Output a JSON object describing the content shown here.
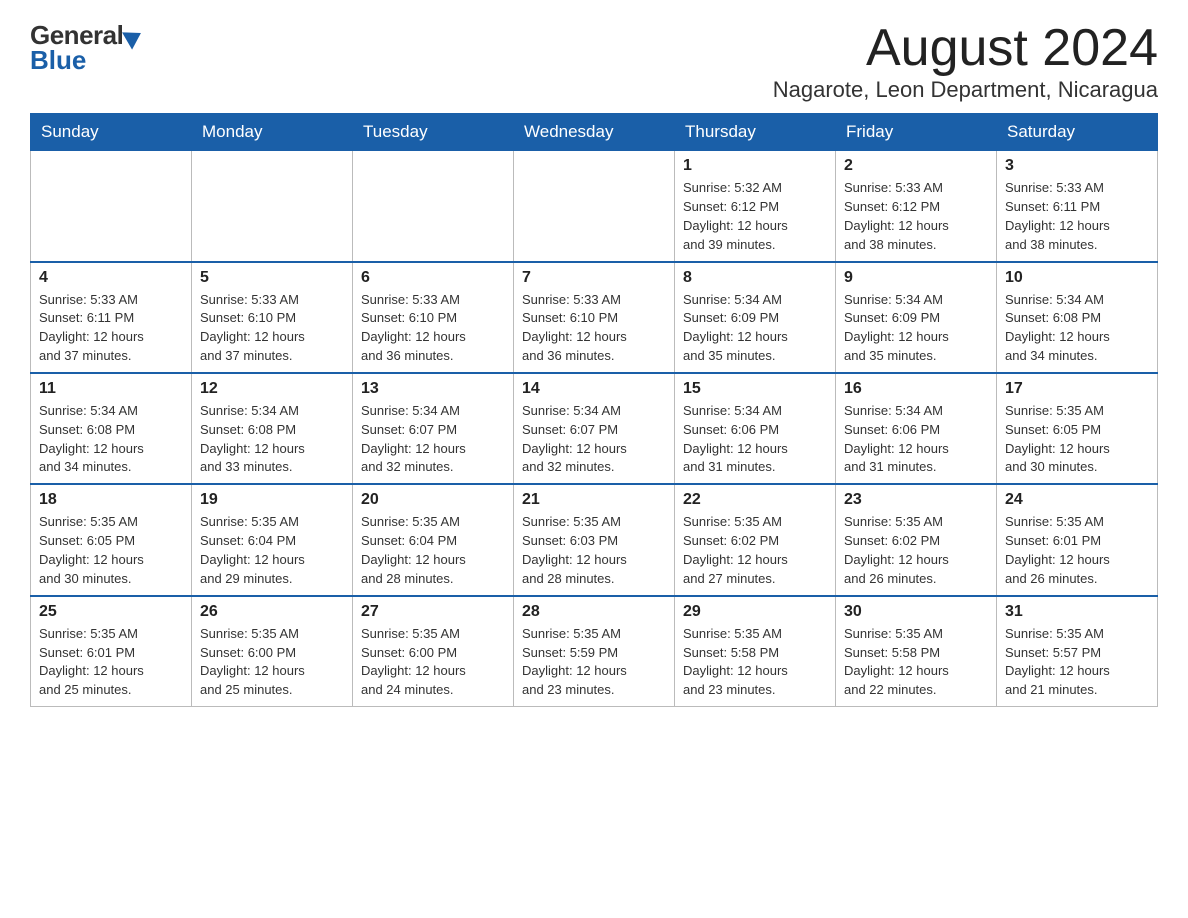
{
  "header": {
    "logo_general": "General",
    "logo_blue": "Blue",
    "month_year": "August 2024",
    "location": "Nagarote, Leon Department, Nicaragua"
  },
  "days_of_week": [
    "Sunday",
    "Monday",
    "Tuesday",
    "Wednesday",
    "Thursday",
    "Friday",
    "Saturday"
  ],
  "weeks": [
    [
      {
        "day": "",
        "info": ""
      },
      {
        "day": "",
        "info": ""
      },
      {
        "day": "",
        "info": ""
      },
      {
        "day": "",
        "info": ""
      },
      {
        "day": "1",
        "info": "Sunrise: 5:32 AM\nSunset: 6:12 PM\nDaylight: 12 hours\nand 39 minutes."
      },
      {
        "day": "2",
        "info": "Sunrise: 5:33 AM\nSunset: 6:12 PM\nDaylight: 12 hours\nand 38 minutes."
      },
      {
        "day": "3",
        "info": "Sunrise: 5:33 AM\nSunset: 6:11 PM\nDaylight: 12 hours\nand 38 minutes."
      }
    ],
    [
      {
        "day": "4",
        "info": "Sunrise: 5:33 AM\nSunset: 6:11 PM\nDaylight: 12 hours\nand 37 minutes."
      },
      {
        "day": "5",
        "info": "Sunrise: 5:33 AM\nSunset: 6:10 PM\nDaylight: 12 hours\nand 37 minutes."
      },
      {
        "day": "6",
        "info": "Sunrise: 5:33 AM\nSunset: 6:10 PM\nDaylight: 12 hours\nand 36 minutes."
      },
      {
        "day": "7",
        "info": "Sunrise: 5:33 AM\nSunset: 6:10 PM\nDaylight: 12 hours\nand 36 minutes."
      },
      {
        "day": "8",
        "info": "Sunrise: 5:34 AM\nSunset: 6:09 PM\nDaylight: 12 hours\nand 35 minutes."
      },
      {
        "day": "9",
        "info": "Sunrise: 5:34 AM\nSunset: 6:09 PM\nDaylight: 12 hours\nand 35 minutes."
      },
      {
        "day": "10",
        "info": "Sunrise: 5:34 AM\nSunset: 6:08 PM\nDaylight: 12 hours\nand 34 minutes."
      }
    ],
    [
      {
        "day": "11",
        "info": "Sunrise: 5:34 AM\nSunset: 6:08 PM\nDaylight: 12 hours\nand 34 minutes."
      },
      {
        "day": "12",
        "info": "Sunrise: 5:34 AM\nSunset: 6:08 PM\nDaylight: 12 hours\nand 33 minutes."
      },
      {
        "day": "13",
        "info": "Sunrise: 5:34 AM\nSunset: 6:07 PM\nDaylight: 12 hours\nand 32 minutes."
      },
      {
        "day": "14",
        "info": "Sunrise: 5:34 AM\nSunset: 6:07 PM\nDaylight: 12 hours\nand 32 minutes."
      },
      {
        "day": "15",
        "info": "Sunrise: 5:34 AM\nSunset: 6:06 PM\nDaylight: 12 hours\nand 31 minutes."
      },
      {
        "day": "16",
        "info": "Sunrise: 5:34 AM\nSunset: 6:06 PM\nDaylight: 12 hours\nand 31 minutes."
      },
      {
        "day": "17",
        "info": "Sunrise: 5:35 AM\nSunset: 6:05 PM\nDaylight: 12 hours\nand 30 minutes."
      }
    ],
    [
      {
        "day": "18",
        "info": "Sunrise: 5:35 AM\nSunset: 6:05 PM\nDaylight: 12 hours\nand 30 minutes."
      },
      {
        "day": "19",
        "info": "Sunrise: 5:35 AM\nSunset: 6:04 PM\nDaylight: 12 hours\nand 29 minutes."
      },
      {
        "day": "20",
        "info": "Sunrise: 5:35 AM\nSunset: 6:04 PM\nDaylight: 12 hours\nand 28 minutes."
      },
      {
        "day": "21",
        "info": "Sunrise: 5:35 AM\nSunset: 6:03 PM\nDaylight: 12 hours\nand 28 minutes."
      },
      {
        "day": "22",
        "info": "Sunrise: 5:35 AM\nSunset: 6:02 PM\nDaylight: 12 hours\nand 27 minutes."
      },
      {
        "day": "23",
        "info": "Sunrise: 5:35 AM\nSunset: 6:02 PM\nDaylight: 12 hours\nand 26 minutes."
      },
      {
        "day": "24",
        "info": "Sunrise: 5:35 AM\nSunset: 6:01 PM\nDaylight: 12 hours\nand 26 minutes."
      }
    ],
    [
      {
        "day": "25",
        "info": "Sunrise: 5:35 AM\nSunset: 6:01 PM\nDaylight: 12 hours\nand 25 minutes."
      },
      {
        "day": "26",
        "info": "Sunrise: 5:35 AM\nSunset: 6:00 PM\nDaylight: 12 hours\nand 25 minutes."
      },
      {
        "day": "27",
        "info": "Sunrise: 5:35 AM\nSunset: 6:00 PM\nDaylight: 12 hours\nand 24 minutes."
      },
      {
        "day": "28",
        "info": "Sunrise: 5:35 AM\nSunset: 5:59 PM\nDaylight: 12 hours\nand 23 minutes."
      },
      {
        "day": "29",
        "info": "Sunrise: 5:35 AM\nSunset: 5:58 PM\nDaylight: 12 hours\nand 23 minutes."
      },
      {
        "day": "30",
        "info": "Sunrise: 5:35 AM\nSunset: 5:58 PM\nDaylight: 12 hours\nand 22 minutes."
      },
      {
        "day": "31",
        "info": "Sunrise: 5:35 AM\nSunset: 5:57 PM\nDaylight: 12 hours\nand 21 minutes."
      }
    ]
  ]
}
